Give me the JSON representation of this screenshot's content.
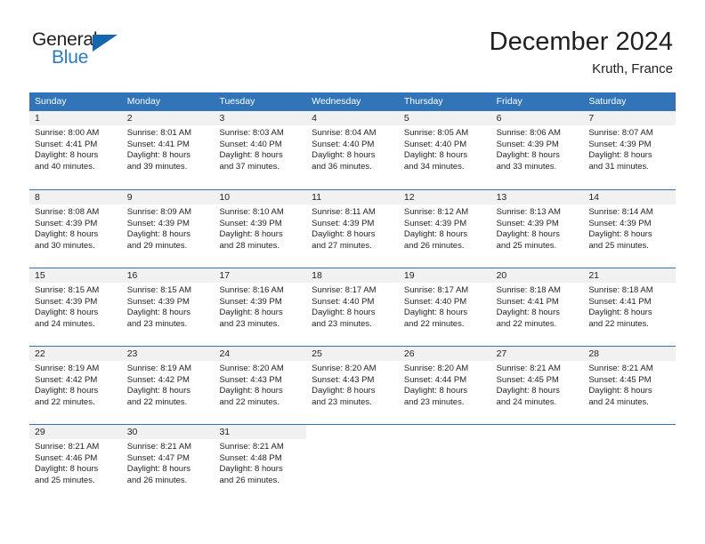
{
  "brand": {
    "name_part1": "General",
    "name_part2": "Blue",
    "triangle_color": "#1566ae",
    "blue_text_color": "#2b7bc0"
  },
  "header": {
    "title": "December 2024",
    "location": "Kruth, France"
  },
  "theme": {
    "header_blue": "#3175b8",
    "date_band_gray": "#f1f1f1",
    "text_color": "#231f20"
  },
  "calendar": {
    "day_names": [
      "Sunday",
      "Monday",
      "Tuesday",
      "Wednesday",
      "Thursday",
      "Friday",
      "Saturday"
    ],
    "weeks": [
      [
        {
          "date": "1",
          "sunrise": "Sunrise: 8:00 AM",
          "sunset": "Sunset: 4:41 PM",
          "daylight_line1": "Daylight: 8 hours",
          "daylight_line2": "and 40 minutes."
        },
        {
          "date": "2",
          "sunrise": "Sunrise: 8:01 AM",
          "sunset": "Sunset: 4:41 PM",
          "daylight_line1": "Daylight: 8 hours",
          "daylight_line2": "and 39 minutes."
        },
        {
          "date": "3",
          "sunrise": "Sunrise: 8:03 AM",
          "sunset": "Sunset: 4:40 PM",
          "daylight_line1": "Daylight: 8 hours",
          "daylight_line2": "and 37 minutes."
        },
        {
          "date": "4",
          "sunrise": "Sunrise: 8:04 AM",
          "sunset": "Sunset: 4:40 PM",
          "daylight_line1": "Daylight: 8 hours",
          "daylight_line2": "and 36 minutes."
        },
        {
          "date": "5",
          "sunrise": "Sunrise: 8:05 AM",
          "sunset": "Sunset: 4:40 PM",
          "daylight_line1": "Daylight: 8 hours",
          "daylight_line2": "and 34 minutes."
        },
        {
          "date": "6",
          "sunrise": "Sunrise: 8:06 AM",
          "sunset": "Sunset: 4:39 PM",
          "daylight_line1": "Daylight: 8 hours",
          "daylight_line2": "and 33 minutes."
        },
        {
          "date": "7",
          "sunrise": "Sunrise: 8:07 AM",
          "sunset": "Sunset: 4:39 PM",
          "daylight_line1": "Daylight: 8 hours",
          "daylight_line2": "and 31 minutes."
        }
      ],
      [
        {
          "date": "8",
          "sunrise": "Sunrise: 8:08 AM",
          "sunset": "Sunset: 4:39 PM",
          "daylight_line1": "Daylight: 8 hours",
          "daylight_line2": "and 30 minutes."
        },
        {
          "date": "9",
          "sunrise": "Sunrise: 8:09 AM",
          "sunset": "Sunset: 4:39 PM",
          "daylight_line1": "Daylight: 8 hours",
          "daylight_line2": "and 29 minutes."
        },
        {
          "date": "10",
          "sunrise": "Sunrise: 8:10 AM",
          "sunset": "Sunset: 4:39 PM",
          "daylight_line1": "Daylight: 8 hours",
          "daylight_line2": "and 28 minutes."
        },
        {
          "date": "11",
          "sunrise": "Sunrise: 8:11 AM",
          "sunset": "Sunset: 4:39 PM",
          "daylight_line1": "Daylight: 8 hours",
          "daylight_line2": "and 27 minutes."
        },
        {
          "date": "12",
          "sunrise": "Sunrise: 8:12 AM",
          "sunset": "Sunset: 4:39 PM",
          "daylight_line1": "Daylight: 8 hours",
          "daylight_line2": "and 26 minutes."
        },
        {
          "date": "13",
          "sunrise": "Sunrise: 8:13 AM",
          "sunset": "Sunset: 4:39 PM",
          "daylight_line1": "Daylight: 8 hours",
          "daylight_line2": "and 25 minutes."
        },
        {
          "date": "14",
          "sunrise": "Sunrise: 8:14 AM",
          "sunset": "Sunset: 4:39 PM",
          "daylight_line1": "Daylight: 8 hours",
          "daylight_line2": "and 25 minutes."
        }
      ],
      [
        {
          "date": "15",
          "sunrise": "Sunrise: 8:15 AM",
          "sunset": "Sunset: 4:39 PM",
          "daylight_line1": "Daylight: 8 hours",
          "daylight_line2": "and 24 minutes."
        },
        {
          "date": "16",
          "sunrise": "Sunrise: 8:15 AM",
          "sunset": "Sunset: 4:39 PM",
          "daylight_line1": "Daylight: 8 hours",
          "daylight_line2": "and 23 minutes."
        },
        {
          "date": "17",
          "sunrise": "Sunrise: 8:16 AM",
          "sunset": "Sunset: 4:39 PM",
          "daylight_line1": "Daylight: 8 hours",
          "daylight_line2": "and 23 minutes."
        },
        {
          "date": "18",
          "sunrise": "Sunrise: 8:17 AM",
          "sunset": "Sunset: 4:40 PM",
          "daylight_line1": "Daylight: 8 hours",
          "daylight_line2": "and 23 minutes."
        },
        {
          "date": "19",
          "sunrise": "Sunrise: 8:17 AM",
          "sunset": "Sunset: 4:40 PM",
          "daylight_line1": "Daylight: 8 hours",
          "daylight_line2": "and 22 minutes."
        },
        {
          "date": "20",
          "sunrise": "Sunrise: 8:18 AM",
          "sunset": "Sunset: 4:41 PM",
          "daylight_line1": "Daylight: 8 hours",
          "daylight_line2": "and 22 minutes."
        },
        {
          "date": "21",
          "sunrise": "Sunrise: 8:18 AM",
          "sunset": "Sunset: 4:41 PM",
          "daylight_line1": "Daylight: 8 hours",
          "daylight_line2": "and 22 minutes."
        }
      ],
      [
        {
          "date": "22",
          "sunrise": "Sunrise: 8:19 AM",
          "sunset": "Sunset: 4:42 PM",
          "daylight_line1": "Daylight: 8 hours",
          "daylight_line2": "and 22 minutes."
        },
        {
          "date": "23",
          "sunrise": "Sunrise: 8:19 AM",
          "sunset": "Sunset: 4:42 PM",
          "daylight_line1": "Daylight: 8 hours",
          "daylight_line2": "and 22 minutes."
        },
        {
          "date": "24",
          "sunrise": "Sunrise: 8:20 AM",
          "sunset": "Sunset: 4:43 PM",
          "daylight_line1": "Daylight: 8 hours",
          "daylight_line2": "and 22 minutes."
        },
        {
          "date": "25",
          "sunrise": "Sunrise: 8:20 AM",
          "sunset": "Sunset: 4:43 PM",
          "daylight_line1": "Daylight: 8 hours",
          "daylight_line2": "and 23 minutes."
        },
        {
          "date": "26",
          "sunrise": "Sunrise: 8:20 AM",
          "sunset": "Sunset: 4:44 PM",
          "daylight_line1": "Daylight: 8 hours",
          "daylight_line2": "and 23 minutes."
        },
        {
          "date": "27",
          "sunrise": "Sunrise: 8:21 AM",
          "sunset": "Sunset: 4:45 PM",
          "daylight_line1": "Daylight: 8 hours",
          "daylight_line2": "and 24 minutes."
        },
        {
          "date": "28",
          "sunrise": "Sunrise: 8:21 AM",
          "sunset": "Sunset: 4:45 PM",
          "daylight_line1": "Daylight: 8 hours",
          "daylight_line2": "and 24 minutes."
        }
      ],
      [
        {
          "date": "29",
          "sunrise": "Sunrise: 8:21 AM",
          "sunset": "Sunset: 4:46 PM",
          "daylight_line1": "Daylight: 8 hours",
          "daylight_line2": "and 25 minutes."
        },
        {
          "date": "30",
          "sunrise": "Sunrise: 8:21 AM",
          "sunset": "Sunset: 4:47 PM",
          "daylight_line1": "Daylight: 8 hours",
          "daylight_line2": "and 26 minutes."
        },
        {
          "date": "31",
          "sunrise": "Sunrise: 8:21 AM",
          "sunset": "Sunset: 4:48 PM",
          "daylight_line1": "Daylight: 8 hours",
          "daylight_line2": "and 26 minutes."
        },
        {
          "date": "",
          "sunrise": "",
          "sunset": "",
          "daylight_line1": "",
          "daylight_line2": ""
        },
        {
          "date": "",
          "sunrise": "",
          "sunset": "",
          "daylight_line1": "",
          "daylight_line2": ""
        },
        {
          "date": "",
          "sunrise": "",
          "sunset": "",
          "daylight_line1": "",
          "daylight_line2": ""
        },
        {
          "date": "",
          "sunrise": "",
          "sunset": "",
          "daylight_line1": "",
          "daylight_line2": ""
        }
      ]
    ]
  }
}
